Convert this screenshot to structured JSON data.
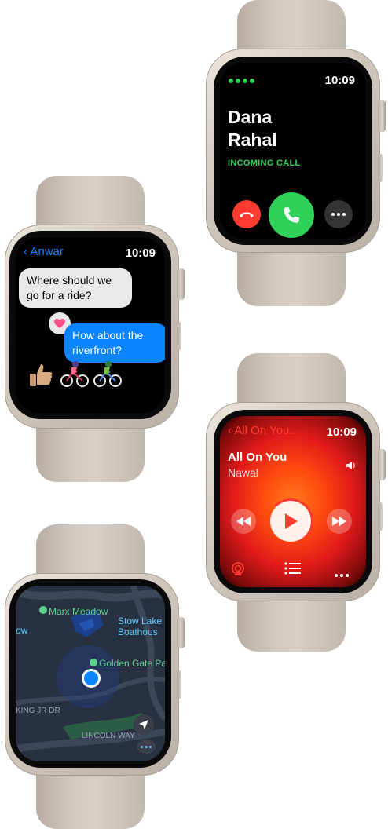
{
  "call": {
    "time": "10:09",
    "caller_first": "Dana",
    "caller_last": "Rahal",
    "status": "INCOMING CALL",
    "decline_icon": "phone-down-icon",
    "accept_icon": "phone-icon",
    "more_icon": "ellipsis-icon",
    "colors": {
      "accent": "#30d158",
      "decline": "#ff3b30"
    }
  },
  "messages": {
    "back_label": "Anwar",
    "time": "10:09",
    "incoming_text": "Where should we go for a ride?",
    "outgoing_text": "How about the riverfront?",
    "tapback_icon": "heart-icon",
    "stickers": [
      "thumbs-up-icon",
      "cyclist-icon",
      "cyclist-icon"
    ]
  },
  "music": {
    "back_label": "All On You...",
    "time": "10:09",
    "song_title": "All On You",
    "artist": "Nawal",
    "volume_icon": "speaker-icon",
    "play_icon": "play-icon",
    "rewind_icon": "rewind-icon",
    "forward_icon": "fast-forward-icon",
    "airplay_icon": "airplay-icon",
    "list_icon": "list-icon",
    "more_icon": "ellipsis-icon",
    "accent": "#ff3b30"
  },
  "maps": {
    "places": [
      "Marx Meadow",
      "Stow Lake Boathouse",
      "Golden Gate Park"
    ],
    "place_line1": "Stow Lake",
    "place_line2": "Boathous",
    "place_left": "ow",
    "street1": "KING JR DR",
    "street2": "LINCOLN WAY",
    "location_icon": "current-location-icon",
    "locate_icon": "location-arrow-icon",
    "more_icon": "ellipsis-icon"
  }
}
